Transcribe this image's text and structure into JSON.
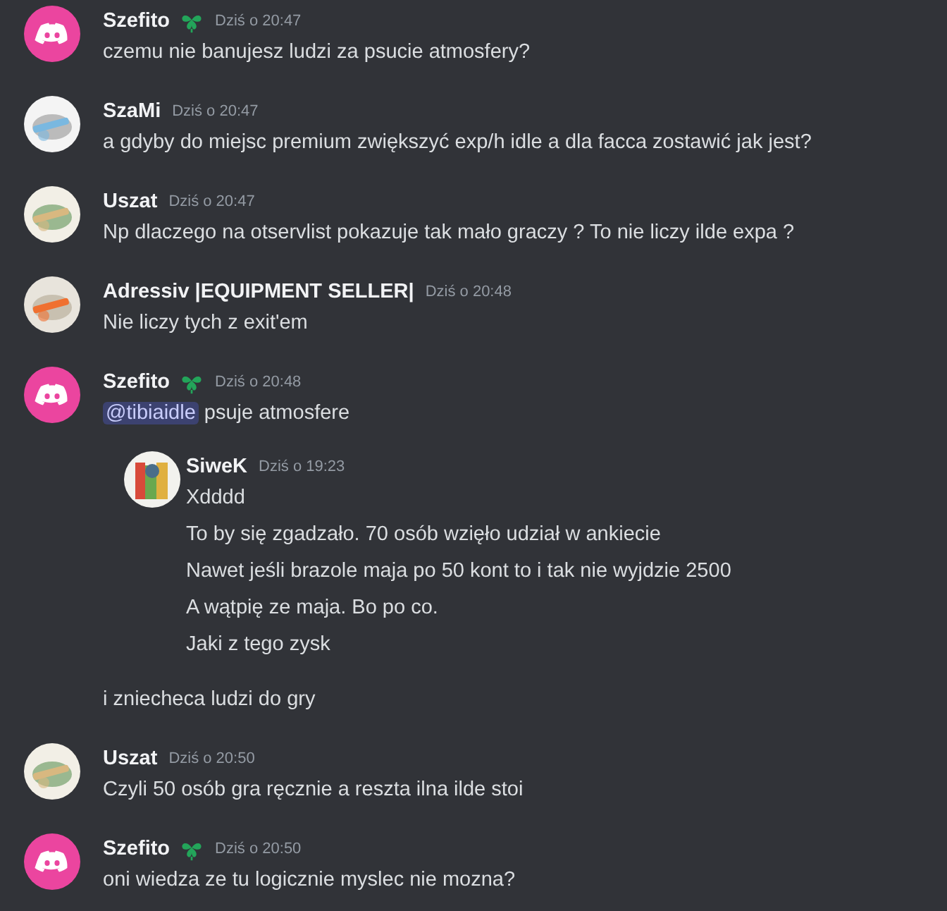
{
  "messages": [
    {
      "author": "Szefito",
      "badge": true,
      "time": "Dziś o 20:47",
      "kind": "discord",
      "content": [
        {
          "kind": "text",
          "text": "czemu nie banujesz ludzi za psucie atmosfery?"
        }
      ]
    },
    {
      "author": "SzaMi",
      "badge": false,
      "time": "Dziś o 20:47",
      "kind": "picture",
      "content": [
        {
          "kind": "text",
          "text": "a gdyby do miejsc premium zwiększyć exp/h idle a dla facca zostawić jak jest?"
        }
      ]
    },
    {
      "author": "Uszat",
      "badge": false,
      "time": "Dziś o 20:47",
      "kind": "picture",
      "content": [
        {
          "kind": "text",
          "text": "Np dlaczego na otservlist pokazuje tak mało graczy ? To nie liczy ilde expa ?"
        }
      ]
    },
    {
      "author": "Adressiv |EQUIPMENT SELLER|",
      "badge": false,
      "time": "Dziś o 20:48",
      "kind": "picture",
      "content": [
        {
          "kind": "text",
          "text": "Nie liczy tych z exit'em"
        }
      ]
    },
    {
      "author": "Szefito",
      "badge": true,
      "time": "Dziś o 20:48",
      "kind": "discord",
      "content": [
        {
          "kind": "mention",
          "mention": "@tibiaidle",
          "text": "psuje atmosfere"
        },
        {
          "kind": "quote",
          "author": "SiweK",
          "time": "Dziś o 19:23",
          "lines": [
            "Xdddd",
            "To by się zgadzało. 70 osób wzięło udział w ankiecie",
            "Nawet jeśli brazole maja po 50 kont to i tak nie wyjdzie 2500",
            "A wątpię ze maja. Bo po co.",
            "Jaki z tego zysk"
          ]
        },
        {
          "kind": "text",
          "text": "i zniecheca ludzi do gry"
        }
      ]
    },
    {
      "author": "Uszat",
      "badge": false,
      "time": "Dziś o 20:50",
      "kind": "picture",
      "content": [
        {
          "kind": "text",
          "text": "Czyli 50 osób gra ręcznie a reszta ilna ilde stoi"
        }
      ]
    },
    {
      "author": "Szefito",
      "badge": true,
      "time": "Dziś o 20:50",
      "kind": "discord",
      "content": [
        {
          "kind": "text",
          "text": "oni wiedza ze tu logicznie myslec nie mozna?"
        }
      ]
    }
  ]
}
